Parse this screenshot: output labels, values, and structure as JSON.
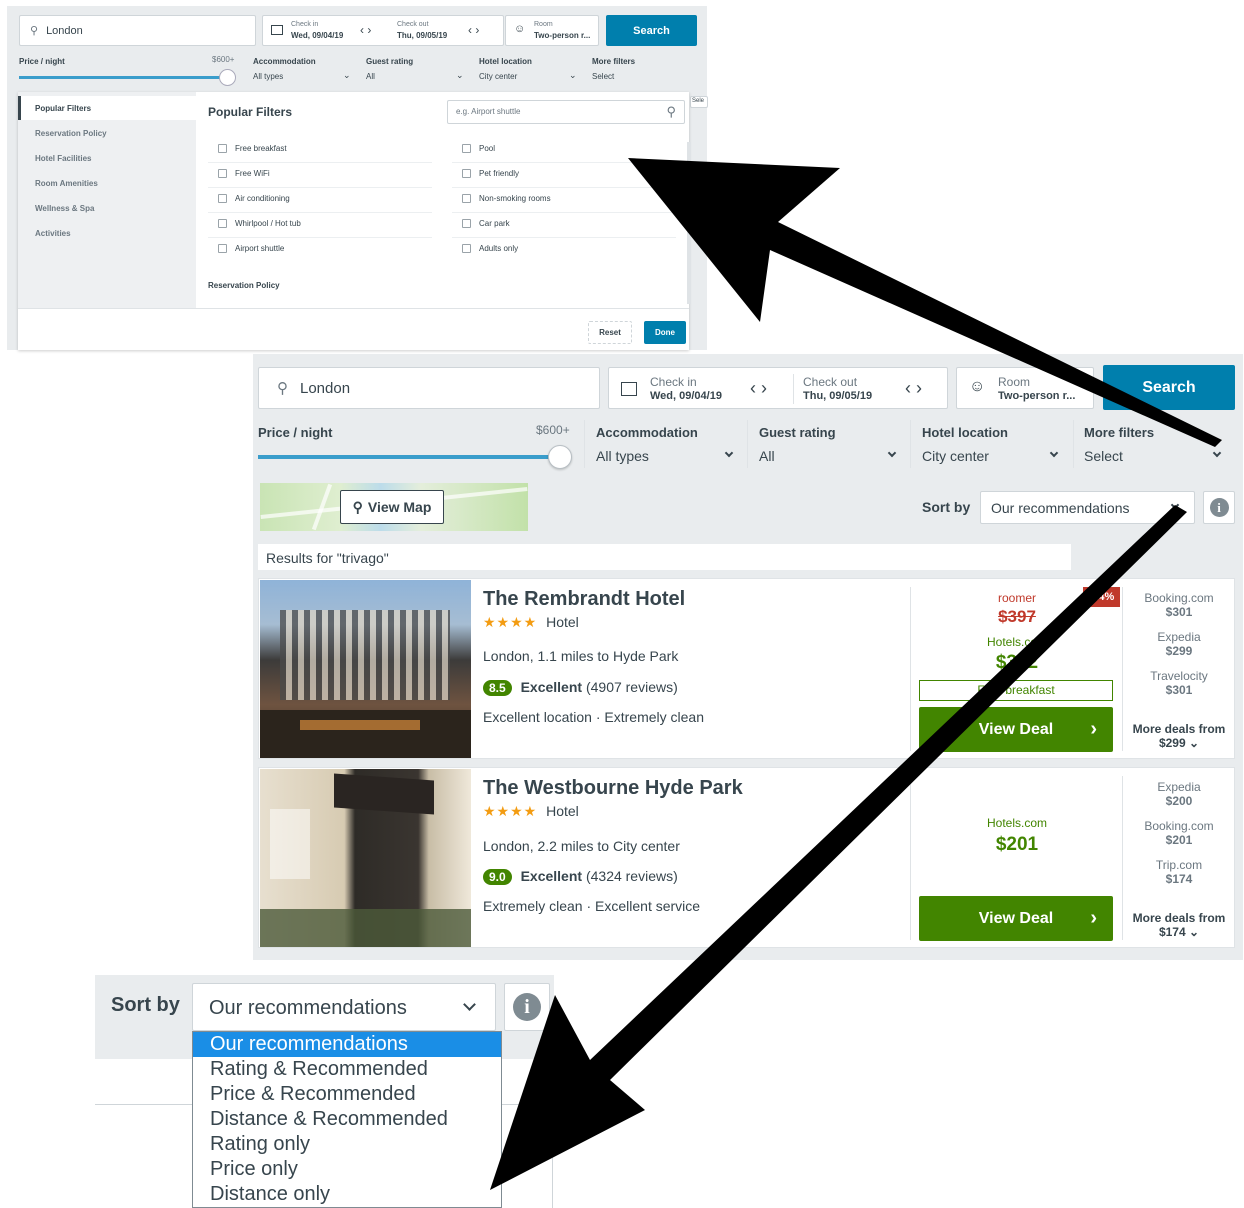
{
  "top_panel": {
    "search_value": "London",
    "checkin_label": "Check in",
    "checkin_value": "Wed, 09/04/19",
    "checkout_label": "Check out",
    "checkout_value": "Thu, 09/05/19",
    "room_label": "Room",
    "room_value": "Two-person r...",
    "search_button": "Search",
    "price_label": "Price / night",
    "price_max": "$600+",
    "accommodation_label": "Accommodation",
    "accommodation_value": "All types",
    "guest_rating_label": "Guest rating",
    "guest_rating_value": "All",
    "hotel_location_label": "Hotel location",
    "hotel_location_value": "City center",
    "more_filters_label": "More filters",
    "more_filters_value": "Select",
    "side_tab_text": "Sele",
    "categories": [
      "Popular Filters",
      "Reservation Policy",
      "Hotel Facilities",
      "Room Amenities",
      "Wellness & Spa",
      "Activities"
    ],
    "panel_title": "Popular Filters",
    "filter_search_placeholder": "e.g. Airport shuttle",
    "filters_left": [
      "Free breakfast",
      "Free WiFi",
      "Air conditioning",
      "Whirlpool / Hot tub",
      "Airport shuttle"
    ],
    "filters_right": [
      "Pool",
      "Pet friendly",
      "Non-smoking rooms",
      "Car park",
      "Adults only"
    ],
    "section2_title": "Reservation Policy",
    "reset_button": "Reset",
    "done_button": "Done"
  },
  "main": {
    "search_value": "London",
    "checkin_label": "Check in",
    "checkin_value": "Wed, 09/04/19",
    "checkout_label": "Check out",
    "checkout_value": "Thu, 09/05/19",
    "room_label": "Room",
    "room_value": "Two-person r...",
    "search_button": "Search",
    "price_label": "Price / night",
    "price_max": "$600+",
    "price_slider_level": 1.0,
    "accommodation_label": "Accommodation",
    "accommodation_value": "All types",
    "guest_rating_label": "Guest rating",
    "guest_rating_value": "All",
    "hotel_location_label": "Hotel location",
    "hotel_location_value": "City center",
    "more_filters_label": "More filters",
    "more_filters_value": "Select",
    "view_map_button": "View Map",
    "sort_label": "Sort by",
    "sort_value": "Our recommendations",
    "results_text": "Results for \"trivago\"",
    "hotels": [
      {
        "name": "The Rembrandt Hotel",
        "stars": "★★★★",
        "type": "Hotel",
        "distance": "London, 1.1 miles to Hyde Park",
        "rating": "8.5",
        "rating_word": "Excellent",
        "reviews": "(4907 reviews)",
        "highlights": "Excellent location · Extremely clean",
        "deal_site_top": "roomer",
        "deal_price_strike": "$397",
        "discount_badge": "-24%",
        "deal_site": "Hotels.com",
        "deal_price": "$302",
        "deal_extra": "Free breakfast",
        "view_deal": "View Deal",
        "others": [
          {
            "site": "Booking.com",
            "price": "$301"
          },
          {
            "site": "Expedia",
            "price": "$299"
          },
          {
            "site": "Travelocity",
            "price": "$301"
          }
        ],
        "more_deals_label": "More deals from",
        "more_deals_price": "$299"
      },
      {
        "name": "The Westbourne Hyde Park",
        "stars": "★★★★",
        "type": "Hotel",
        "distance": "London, 2.2 miles to City center",
        "rating": "9.0",
        "rating_word": "Excellent",
        "reviews": "(4324 reviews)",
        "highlights": "Extremely clean · Excellent service",
        "deal_site": "Hotels.com",
        "deal_price": "$201",
        "view_deal": "View Deal",
        "others": [
          {
            "site": "Expedia",
            "price": "$200"
          },
          {
            "site": "Booking.com",
            "price": "$201"
          },
          {
            "site": "Trip.com",
            "price": "$174"
          }
        ],
        "more_deals_label": "More deals from",
        "more_deals_price": "$174"
      }
    ]
  },
  "sort_zoom": {
    "label": "Sort by",
    "value": "Our recommendations",
    "options": [
      "Our recommendations",
      "Rating & Recommended",
      "Price & Recommended",
      "Distance & Recommended",
      "Rating only",
      "Price only",
      "Distance only"
    ],
    "selected_index": 0
  },
  "colors": {
    "brand_blue": "#007fad",
    "deal_green": "#428500",
    "strike_red": "#c0392b",
    "star_orange": "#f39c12",
    "selected_option_bg": "#1a8ee6"
  }
}
